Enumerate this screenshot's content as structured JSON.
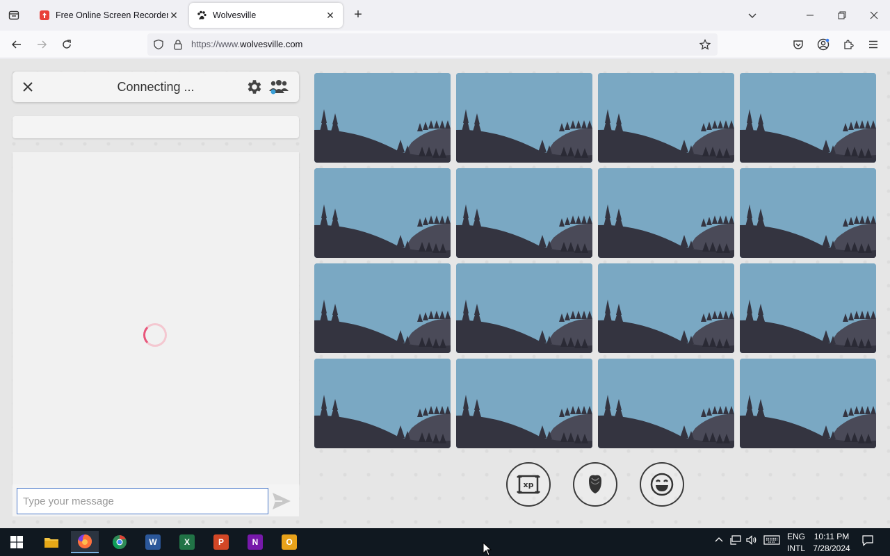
{
  "browser": {
    "tabs": [
      {
        "title": "Free Online Screen Recorder & ",
        "favicon": "recorder-icon",
        "active": false
      },
      {
        "title": "Wolvesville",
        "favicon": "paw-icon",
        "active": true
      }
    ],
    "url_prefix": "https://www.",
    "url_domain": "wolvesville.com"
  },
  "chat": {
    "status": "Connecting ...",
    "input_placeholder": "Type your message"
  },
  "grid": {
    "rows": 4,
    "cols": 4,
    "card_icon": "landscape-placeholder"
  },
  "actions": [
    {
      "name": "xp-button",
      "icon": "xp-scroll-icon",
      "label": "xp"
    },
    {
      "name": "rose-button",
      "icon": "rose-icon"
    },
    {
      "name": "emoji-button",
      "icon": "smile-icon"
    }
  ],
  "taskbar": {
    "lang_top": "ENG",
    "lang_bottom": "INTL",
    "time": "10:11 PM",
    "date": "7/28/2024"
  }
}
